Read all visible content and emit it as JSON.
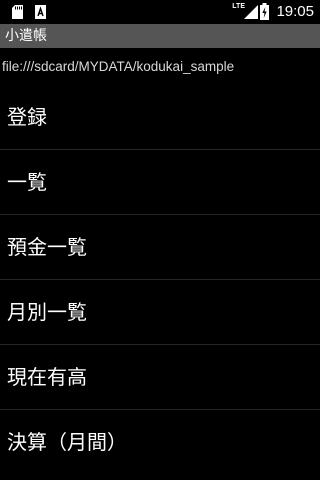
{
  "statusbar": {
    "left_icons": [
      "sd-card-icon",
      "a-notification-icon"
    ],
    "network_label": "LTE",
    "time": "19:05"
  },
  "titlebar": {
    "title": "小遣帳",
    "background": "#555555"
  },
  "path": {
    "text": "file:///sdcard/MYDATA/kodukai_sample"
  },
  "menu": {
    "items": [
      {
        "label": "登録"
      },
      {
        "label": "一覧"
      },
      {
        "label": "預金一覧"
      },
      {
        "label": "月別一覧"
      },
      {
        "label": "現在有高"
      },
      {
        "label": "決算（月間）"
      }
    ]
  }
}
